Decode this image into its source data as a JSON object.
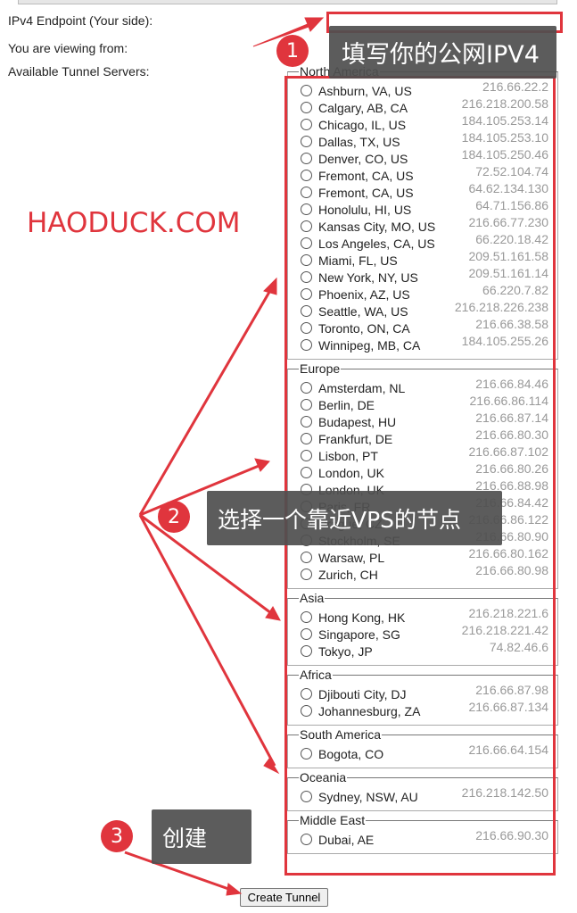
{
  "form": {
    "endpoint_label": "IPv4 Endpoint (Your side):",
    "viewing_label": "You are viewing from:",
    "servers_label": "Available Tunnel Servers:",
    "create_button": "Create Tunnel"
  },
  "regions": [
    {
      "name": "North America",
      "servers": [
        [
          "Ashburn, VA, US",
          "216.66.22.2"
        ],
        [
          "Calgary, AB, CA",
          "216.218.200.58"
        ],
        [
          "Chicago, IL, US",
          "184.105.253.14"
        ],
        [
          "Dallas, TX, US",
          "184.105.253.10"
        ],
        [
          "Denver, CO, US",
          "184.105.250.46"
        ],
        [
          "Fremont, CA, US",
          "72.52.104.74"
        ],
        [
          "Fremont, CA, US",
          "64.62.134.130"
        ],
        [
          "Honolulu, HI, US",
          "64.71.156.86"
        ],
        [
          "Kansas City, MO, US",
          "216.66.77.230"
        ],
        [
          "Los Angeles, CA, US",
          "66.220.18.42"
        ],
        [
          "Miami, FL, US",
          "209.51.161.58"
        ],
        [
          "New York, NY, US",
          "209.51.161.14"
        ],
        [
          "Phoenix, AZ, US",
          "66.220.7.82"
        ],
        [
          "Seattle, WA, US",
          "216.218.226.238"
        ],
        [
          "Toronto, ON, CA",
          "216.66.38.58"
        ],
        [
          "Winnipeg, MB, CA",
          "184.105.255.26"
        ]
      ]
    },
    {
      "name": "Europe",
      "servers": [
        [
          "Amsterdam, NL",
          "216.66.84.46"
        ],
        [
          "Berlin, DE",
          "216.66.86.114"
        ],
        [
          "Budapest, HU",
          "216.66.87.14"
        ],
        [
          "Frankfurt, DE",
          "216.66.80.30"
        ],
        [
          "Lisbon, PT",
          "216.66.87.102"
        ],
        [
          "London, UK",
          "216.66.80.26"
        ],
        [
          "London, UK",
          "216.66.88.98"
        ],
        [
          "Paris, FR",
          "216.66.84.42"
        ],
        [
          "Prague, CZ",
          "216.66.86.122"
        ],
        [
          "Stockholm, SE",
          "216.66.80.90"
        ],
        [
          "Warsaw, PL",
          "216.66.80.162"
        ],
        [
          "Zurich, CH",
          "216.66.80.98"
        ]
      ]
    },
    {
      "name": "Asia",
      "servers": [
        [
          "Hong Kong, HK",
          "216.218.221.6"
        ],
        [
          "Singapore, SG",
          "216.218.221.42"
        ],
        [
          "Tokyo, JP",
          "74.82.46.6"
        ]
      ]
    },
    {
      "name": "Africa",
      "servers": [
        [
          "Djibouti City, DJ",
          "216.66.87.98"
        ],
        [
          "Johannesburg, ZA",
          "216.66.87.134"
        ]
      ]
    },
    {
      "name": "South America",
      "servers": [
        [
          "Bogota, CO",
          "216.66.64.154"
        ]
      ]
    },
    {
      "name": "Oceania",
      "servers": [
        [
          "Sydney, NSW, AU",
          "216.218.142.50"
        ]
      ]
    },
    {
      "name": "Middle East",
      "servers": [
        [
          "Dubai, AE",
          "216.66.90.30"
        ]
      ]
    }
  ],
  "annotations": {
    "brand": "HAODUCK.COM",
    "step1_num": "1",
    "step1_text": "填写你的公网IPV4",
    "step2_num": "2",
    "step2_text": "选择一个靠近VPS的节点",
    "step3_num": "3",
    "step3_text": "创建"
  },
  "colors": {
    "accent": "#e0353d",
    "tooltip": "#505050"
  }
}
